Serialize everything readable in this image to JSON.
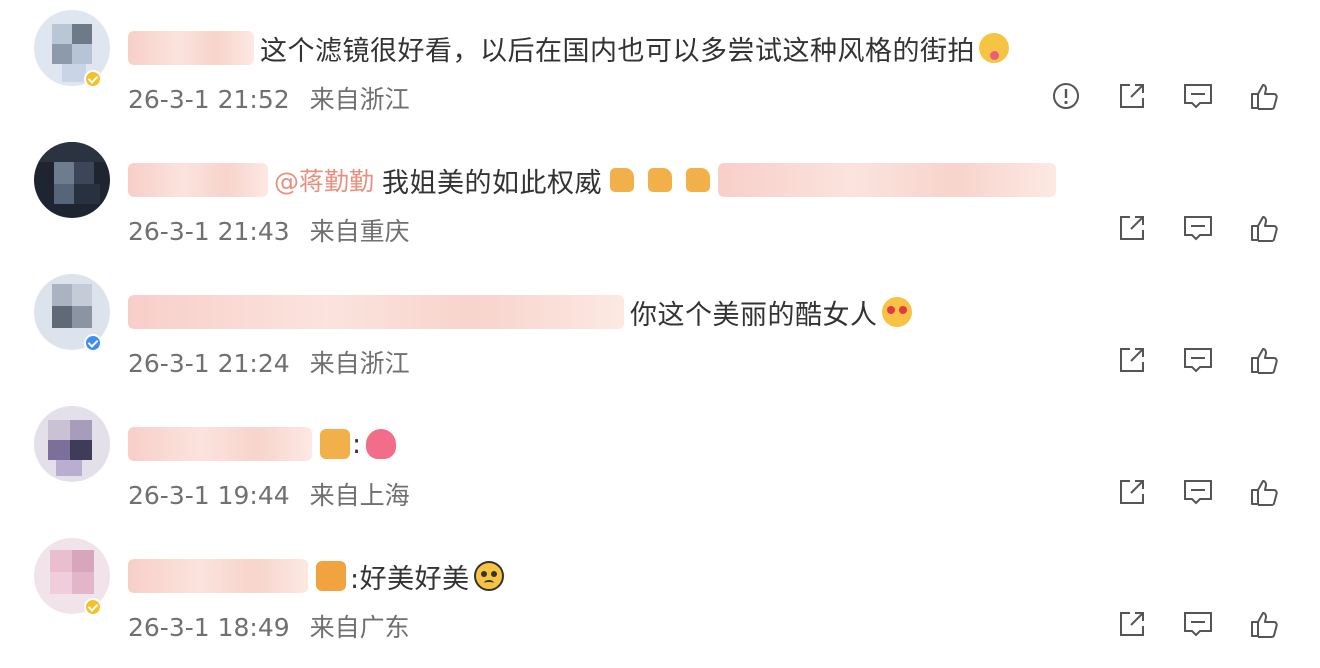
{
  "comments": [
    {
      "text": "这个滤镜很好看，以后在国内也可以多尝试这种风格的街拍",
      "time": "26-3-1 21:52",
      "location": "来自浙江",
      "badge": "gold",
      "emoji": "tongue-face",
      "actions": [
        "report-icon",
        "share-icon",
        "comment-icon",
        "like-icon"
      ]
    },
    {
      "mention": "@蒋勤勤",
      "text": "我姐美的如此权威",
      "time": "26-3-1 21:43",
      "location": "来自重庆",
      "badge": "none",
      "emoji": "thumbs-up x3",
      "actions": [
        "share-icon",
        "comment-icon",
        "like-icon"
      ]
    },
    {
      "text": "你这个美丽的酷女人",
      "time": "26-3-1 21:24",
      "location": "来自浙江",
      "badge": "blue",
      "emoji": "heart-eyes-face",
      "actions": [
        "share-icon",
        "comment-icon",
        "like-icon"
      ]
    },
    {
      "text": ":",
      "time": "26-3-1 19:44",
      "location": "来自上海",
      "badge": "none",
      "emoji": "crown, heart",
      "actions": [
        "share-icon",
        "comment-icon",
        "like-icon"
      ]
    },
    {
      "text": ":好美好美",
      "time": "26-3-1 18:49",
      "location": "来自广东",
      "badge": "gold",
      "emoji": "pleading-face",
      "actions": [
        "share-icon",
        "comment-icon",
        "like-icon"
      ]
    }
  ],
  "colors": {
    "text": "#333333",
    "meta": "#707070",
    "mention": "#e8907f",
    "icon": "#555555",
    "blur": "#f7c9c2"
  }
}
